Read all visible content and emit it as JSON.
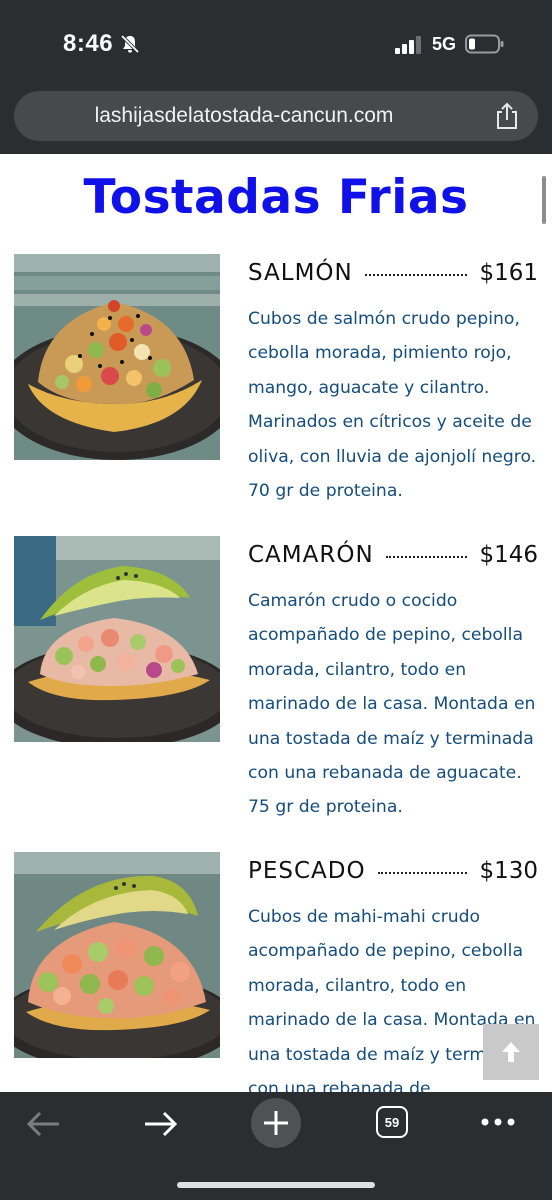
{
  "status_bar": {
    "time": "8:46",
    "network": "5G",
    "icons": [
      "bell-slash-icon",
      "signal-icon",
      "battery-icon"
    ]
  },
  "browser": {
    "url": "lashijasdelatostada-cancun.com",
    "share_icon": "share-icon"
  },
  "page": {
    "title": "Tostadas Frias",
    "title_color": "#1010e8",
    "description_color": "#154d7c"
  },
  "menu": [
    {
      "name": "SALMÓN",
      "price": "$161",
      "description": "Cubos de salmón crudo pepino, cebolla morada, pimiento rojo, mango, aguacate y cilantro. Marinados en cítricos y aceite de oliva, con lluvia de ajonjolí negro. 70 gr de proteina."
    },
    {
      "name": "CAMARÓN",
      "price": "$146",
      "description": "Camarón crudo o cocido acompañado de pepino, cebolla morada, cilantro, todo en marinado de la casa. Montada en una tostada de maíz y terminada con una rebanada de aguacate. 75 gr de proteina."
    },
    {
      "name": "PESCADO",
      "price": "$130",
      "description": "Cubos de mahi-mahi crudo acompañado de pepino, cebolla morada, cilantro, todo en marinado de la casa. Montada en una tostada de maíz y terminada con una rebanada de"
    }
  ],
  "toolbar": {
    "tab_count": "59",
    "icons": [
      "back-arrow-icon",
      "forward-arrow-icon",
      "new-tab-icon",
      "tabs-icon",
      "more-icon"
    ]
  }
}
